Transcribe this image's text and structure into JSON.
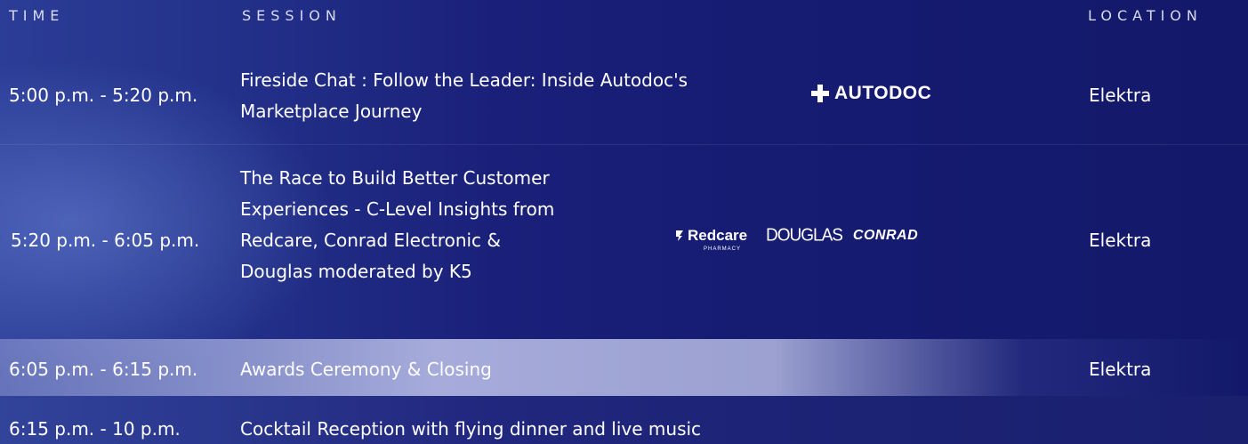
{
  "header": {
    "time": "TIME",
    "session": "SESSION",
    "location": "LOCATION"
  },
  "rows": [
    {
      "time": "5:00 p.m. - 5:20 p.m.",
      "session": "Fireside Chat : Follow the Leader: Inside Autodoc's Marketplace Journey",
      "location": "Elektra",
      "logos": [
        "AUTODOC"
      ]
    },
    {
      "time": "5:20 p.m. - 6:05 p.m.",
      "session": "The Race to Build Better Customer Experiences - C-Level Insights from Redcare, Conrad Electronic & Douglas moderated by K5",
      "location": "Elektra",
      "logos": [
        "Redcare",
        "PHARMACY",
        "DOUGLAS",
        "CONRAD"
      ]
    },
    {
      "time": "6:05 p.m. - 6:15 p.m.",
      "session": "Awards Ceremony & Closing",
      "location": "Elektra"
    },
    {
      "time": "6:15 p.m. - 10 p.m.",
      "session": "Cocktail Reception with flying dinner and live music"
    }
  ],
  "icons": {
    "autodoc": "plus-icon",
    "redcare": "redcare-mark-icon"
  }
}
